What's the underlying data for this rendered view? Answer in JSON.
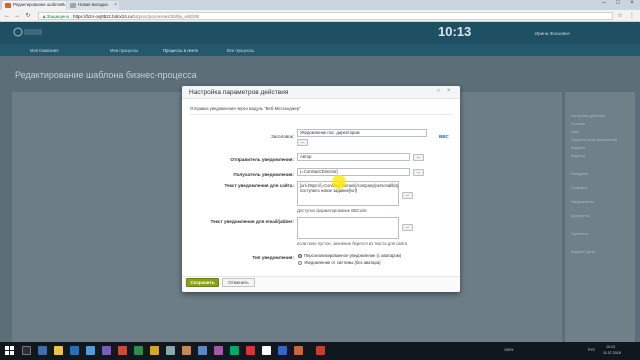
{
  "browser": {
    "tabs": [
      {
        "label": "Редактирование шаблона",
        "active": true,
        "favicon_color": "#e35c2c"
      },
      {
        "label": "Новая вкладка",
        "active": false,
        "favicon_color": "#9aa6b0"
      }
    ],
    "address": {
      "secure_label": "Защищено",
      "host": "https://b24-ovj8b2z.bitrix24.ru",
      "path": "/bizproc/processes/26/bp_edit/28/"
    }
  },
  "portal": {
    "clock": "10:13",
    "user": "Ирина Жоскевич",
    "page_title": "Редактирование шаблона бизнес-процесса",
    "nav": [
      "Моя Компания",
      "Мои процессы",
      "Процессы в ленте",
      "Все процессы"
    ],
    "right_items": [
      "Настройки действия",
      "Условие",
      "Цикл",
      "Параллельное выполнение",
      "Задание",
      "Задания",
      "Ожидание",
      "Отправка",
      "Уведомления",
      "Документы",
      "Элементы",
      "Задание Дела"
    ]
  },
  "dialog": {
    "title": "Настройка параметров действия",
    "min_icon": "□",
    "close_icon": "×",
    "subtitle": "Отправка уведомления через модуль \"Веб-Мессенджер\"",
    "fields": {
      "header_label": "Заголовок:",
      "header_value": "Уведомление пос. директором",
      "sender_label": "Отправитель уведомления:",
      "sender_value": "Автор",
      "recipient_label": "Получатель уведомления:",
      "recipient_value": "{=Constant:Director}",
      "site_text_label": "Текст уведомления для сайта:",
      "site_text_value": "[url=https://{=Constant:domain}/company/personal/bizproc/{=Workflow:ID}/]Вам поступило новое задание[/url]",
      "bbcode_hint": "Доступно форматирование BBCode",
      "bbcode_link": "BBC",
      "email_text_label": "Текст уведомления для email/jabber:",
      "email_text_value": "",
      "email_hint": "если поле пустое, значение берется из текста для сайта",
      "type_label": "Тип уведомления:",
      "type_options": [
        {
          "label": "Персонализированное уведомление (с аватаром)",
          "checked": true
        },
        {
          "label": "Уведомление от системы (без аватара)",
          "checked": false
        }
      ]
    },
    "buttons": {
      "save": "Сохранить",
      "cancel": "Отменить",
      "dots": "..."
    }
  },
  "taskbar": {
    "time": "10:13",
    "date": "11.07.2018",
    "lang": "РУС",
    "battery": "100%"
  }
}
